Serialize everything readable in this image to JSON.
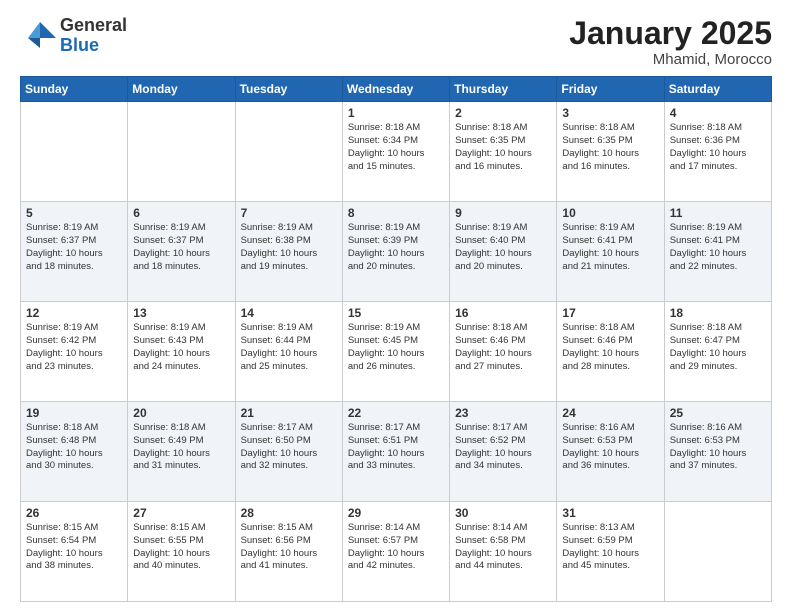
{
  "header": {
    "logo_general": "General",
    "logo_blue": "Blue",
    "month_title": "January 2025",
    "location": "Mhamid, Morocco"
  },
  "weekdays": [
    "Sunday",
    "Monday",
    "Tuesday",
    "Wednesday",
    "Thursday",
    "Friday",
    "Saturday"
  ],
  "weeks": [
    [
      {
        "day": "",
        "text": ""
      },
      {
        "day": "",
        "text": ""
      },
      {
        "day": "",
        "text": ""
      },
      {
        "day": "1",
        "text": "Sunrise: 8:18 AM\nSunset: 6:34 PM\nDaylight: 10 hours\nand 15 minutes."
      },
      {
        "day": "2",
        "text": "Sunrise: 8:18 AM\nSunset: 6:35 PM\nDaylight: 10 hours\nand 16 minutes."
      },
      {
        "day": "3",
        "text": "Sunrise: 8:18 AM\nSunset: 6:35 PM\nDaylight: 10 hours\nand 16 minutes."
      },
      {
        "day": "4",
        "text": "Sunrise: 8:18 AM\nSunset: 6:36 PM\nDaylight: 10 hours\nand 17 minutes."
      }
    ],
    [
      {
        "day": "5",
        "text": "Sunrise: 8:19 AM\nSunset: 6:37 PM\nDaylight: 10 hours\nand 18 minutes."
      },
      {
        "day": "6",
        "text": "Sunrise: 8:19 AM\nSunset: 6:37 PM\nDaylight: 10 hours\nand 18 minutes."
      },
      {
        "day": "7",
        "text": "Sunrise: 8:19 AM\nSunset: 6:38 PM\nDaylight: 10 hours\nand 19 minutes."
      },
      {
        "day": "8",
        "text": "Sunrise: 8:19 AM\nSunset: 6:39 PM\nDaylight: 10 hours\nand 20 minutes."
      },
      {
        "day": "9",
        "text": "Sunrise: 8:19 AM\nSunset: 6:40 PM\nDaylight: 10 hours\nand 20 minutes."
      },
      {
        "day": "10",
        "text": "Sunrise: 8:19 AM\nSunset: 6:41 PM\nDaylight: 10 hours\nand 21 minutes."
      },
      {
        "day": "11",
        "text": "Sunrise: 8:19 AM\nSunset: 6:41 PM\nDaylight: 10 hours\nand 22 minutes."
      }
    ],
    [
      {
        "day": "12",
        "text": "Sunrise: 8:19 AM\nSunset: 6:42 PM\nDaylight: 10 hours\nand 23 minutes."
      },
      {
        "day": "13",
        "text": "Sunrise: 8:19 AM\nSunset: 6:43 PM\nDaylight: 10 hours\nand 24 minutes."
      },
      {
        "day": "14",
        "text": "Sunrise: 8:19 AM\nSunset: 6:44 PM\nDaylight: 10 hours\nand 25 minutes."
      },
      {
        "day": "15",
        "text": "Sunrise: 8:19 AM\nSunset: 6:45 PM\nDaylight: 10 hours\nand 26 minutes."
      },
      {
        "day": "16",
        "text": "Sunrise: 8:18 AM\nSunset: 6:46 PM\nDaylight: 10 hours\nand 27 minutes."
      },
      {
        "day": "17",
        "text": "Sunrise: 8:18 AM\nSunset: 6:46 PM\nDaylight: 10 hours\nand 28 minutes."
      },
      {
        "day": "18",
        "text": "Sunrise: 8:18 AM\nSunset: 6:47 PM\nDaylight: 10 hours\nand 29 minutes."
      }
    ],
    [
      {
        "day": "19",
        "text": "Sunrise: 8:18 AM\nSunset: 6:48 PM\nDaylight: 10 hours\nand 30 minutes."
      },
      {
        "day": "20",
        "text": "Sunrise: 8:18 AM\nSunset: 6:49 PM\nDaylight: 10 hours\nand 31 minutes."
      },
      {
        "day": "21",
        "text": "Sunrise: 8:17 AM\nSunset: 6:50 PM\nDaylight: 10 hours\nand 32 minutes."
      },
      {
        "day": "22",
        "text": "Sunrise: 8:17 AM\nSunset: 6:51 PM\nDaylight: 10 hours\nand 33 minutes."
      },
      {
        "day": "23",
        "text": "Sunrise: 8:17 AM\nSunset: 6:52 PM\nDaylight: 10 hours\nand 34 minutes."
      },
      {
        "day": "24",
        "text": "Sunrise: 8:16 AM\nSunset: 6:53 PM\nDaylight: 10 hours\nand 36 minutes."
      },
      {
        "day": "25",
        "text": "Sunrise: 8:16 AM\nSunset: 6:53 PM\nDaylight: 10 hours\nand 37 minutes."
      }
    ],
    [
      {
        "day": "26",
        "text": "Sunrise: 8:15 AM\nSunset: 6:54 PM\nDaylight: 10 hours\nand 38 minutes."
      },
      {
        "day": "27",
        "text": "Sunrise: 8:15 AM\nSunset: 6:55 PM\nDaylight: 10 hours\nand 40 minutes."
      },
      {
        "day": "28",
        "text": "Sunrise: 8:15 AM\nSunset: 6:56 PM\nDaylight: 10 hours\nand 41 minutes."
      },
      {
        "day": "29",
        "text": "Sunrise: 8:14 AM\nSunset: 6:57 PM\nDaylight: 10 hours\nand 42 minutes."
      },
      {
        "day": "30",
        "text": "Sunrise: 8:14 AM\nSunset: 6:58 PM\nDaylight: 10 hours\nand 44 minutes."
      },
      {
        "day": "31",
        "text": "Sunrise: 8:13 AM\nSunset: 6:59 PM\nDaylight: 10 hours\nand 45 minutes."
      },
      {
        "day": "",
        "text": ""
      }
    ]
  ]
}
